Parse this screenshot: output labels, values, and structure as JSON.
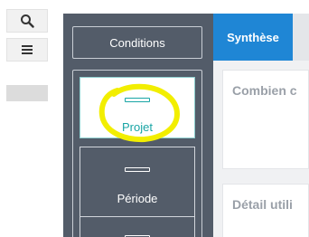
{
  "toolbar": {
    "search_icon": "search-icon",
    "menu_icon": "hamburger-menu-icon"
  },
  "side_panel": {
    "conditions_label": "Conditions",
    "options": [
      {
        "label": "Projet",
        "selected": true
      },
      {
        "label": "Période",
        "selected": false
      },
      {
        "label": "",
        "selected": false
      }
    ],
    "highlight_color": "#f2ee00"
  },
  "main": {
    "active_tab": "Synthèse",
    "cards": [
      {
        "title": "Combien c"
      },
      {
        "title": "Détail utili"
      }
    ]
  },
  "colors": {
    "panel_bg": "#535c69",
    "tab_active": "#1f86d5",
    "selected_text": "#19a5a5"
  }
}
